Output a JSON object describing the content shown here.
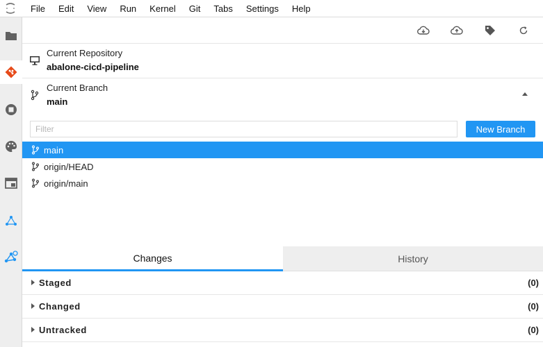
{
  "menubar": {
    "items": [
      "File",
      "Edit",
      "View",
      "Run",
      "Kernel",
      "Git",
      "Tabs",
      "Settings",
      "Help"
    ]
  },
  "activitybar": {
    "icons": [
      "folder-icon",
      "git-icon",
      "running-icon",
      "palette-icon",
      "tab-icon",
      "property-inspector-icon",
      "git-graph-icon"
    ],
    "active": "git-icon"
  },
  "toolbar": {
    "buttons": [
      "cloud-download-icon",
      "cloud-upload-icon",
      "tag-icon",
      "refresh-icon"
    ]
  },
  "repository": {
    "label": "Current Repository",
    "name": "abalone-cicd-pipeline"
  },
  "branch": {
    "label": "Current Branch",
    "name": "main",
    "filter_placeholder": "Filter",
    "new_branch_label": "New Branch",
    "list": [
      "main",
      "origin/HEAD",
      "origin/main"
    ],
    "selected": "main"
  },
  "tabs": {
    "changes": "Changes",
    "history": "History",
    "active": "Changes"
  },
  "groups": {
    "staged": {
      "label": "Staged",
      "count": "(0)"
    },
    "changed": {
      "label": "Changed",
      "count": "(0)"
    },
    "untracked": {
      "label": "Untracked",
      "count": "(0)"
    }
  },
  "colors": {
    "accent": "#2196f3",
    "git_icon": "#e64a19"
  }
}
